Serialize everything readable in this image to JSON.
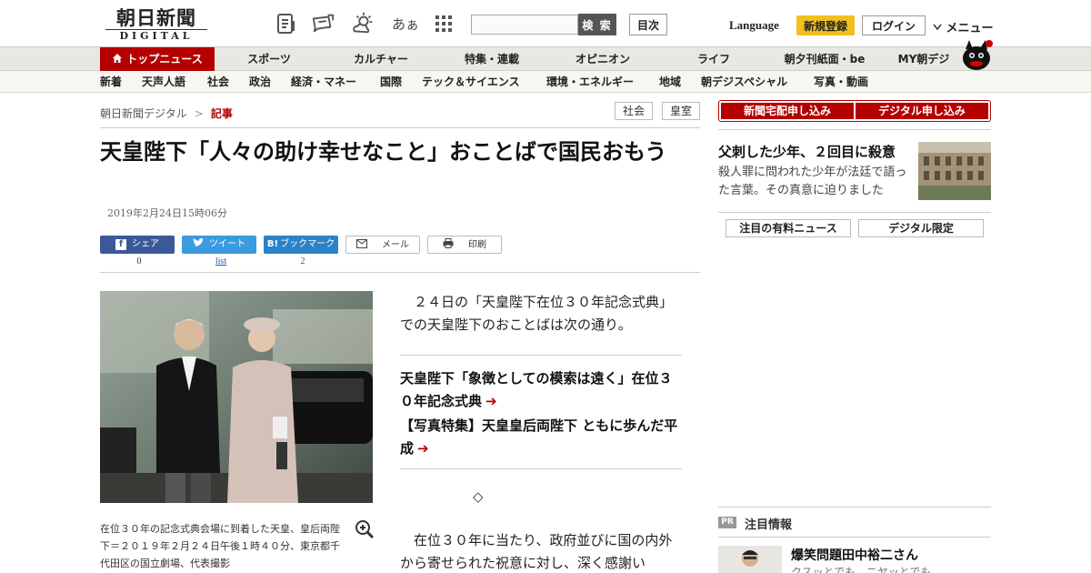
{
  "header": {
    "logo_jp": "朝日新聞",
    "logo_en": "DIGITAL",
    "font_size_glyph": "あぁ",
    "search_placeholder": "",
    "search_label": "検 索",
    "toc_label": "目次",
    "language_label": "Language",
    "register_label": "新規登録",
    "login_label": "ログイン",
    "menu_label": "メニュー"
  },
  "nav_primary": [
    "トップニュース",
    "スポーツ",
    "カルチャー",
    "特集・連載",
    "オピニオン",
    "ライフ",
    "朝夕刊紙面・be",
    "MY朝デジ"
  ],
  "nav_secondary": [
    "新着",
    "天声人語",
    "社会",
    "政治",
    "経済・マネー",
    "国際",
    "テック＆サイエンス",
    "環境・エネルギー",
    "地域",
    "朝デジスペシャル",
    "写真・動画"
  ],
  "breadcrumb": {
    "home": "朝日新聞デジタル",
    "separator": ">",
    "current": "記事"
  },
  "tags": [
    "社会",
    "皇室"
  ],
  "article": {
    "headline": "天皇陛下「人々の助け幸せなこと」おことばで国民おもう",
    "date": "2019年2月24日15時06分",
    "share": {
      "facebook_label": "シェア",
      "facebook_count": "0",
      "twitter_label": "ツイート",
      "twitter_count": "list",
      "hatena_label": "ブックマーク",
      "hatena_icon": "B!",
      "hatena_count": "2",
      "mail_label": "メール",
      "print_label": "印刷"
    },
    "caption": "在位３０年の記念式典会場に到着した天皇、皇后両陛下＝２０１９年２月２４日午後１時４０分、東京都千代田区の国立劇場、代表撮影",
    "lead": "２４日の「天皇陛下在位３０年記念式典」での天皇陛下のおことばは次の通り。",
    "related": [
      "天皇陛下「象徴としての模索は遠く」在位３０年記念式典",
      "【写真特集】天皇皇后両陛下 ともに歩んだ平成"
    ],
    "diamond": "◇",
    "body": "在位３０年に当たり、政府並びに国の内外から寄せられた祝意に対し、深く感謝い"
  },
  "sidebar": {
    "subscribe_paper": "新聞宅配申し込み",
    "subscribe_digital": "デジタル申し込み",
    "feature_title": "父刺した少年、２回目に殺意",
    "feature_desc": "殺人罪に問われた少年が法廷で語った言葉。その真意に迫りました",
    "tab_paid": "注目の有料ニュース",
    "tab_digital": "デジタル限定",
    "pr_label": "PR",
    "pr_section": "注目情報",
    "pr_head": "爆笑問題田中裕二さん",
    "pr_sub": "クスッとでも、ニヤッとでも"
  },
  "colors": {
    "brand_red": "#b40000",
    "nav_bg": "#e9e7e1",
    "register_yellow": "#f0c020",
    "facebook": "#3b5998",
    "twitter": "#3a9be0"
  }
}
